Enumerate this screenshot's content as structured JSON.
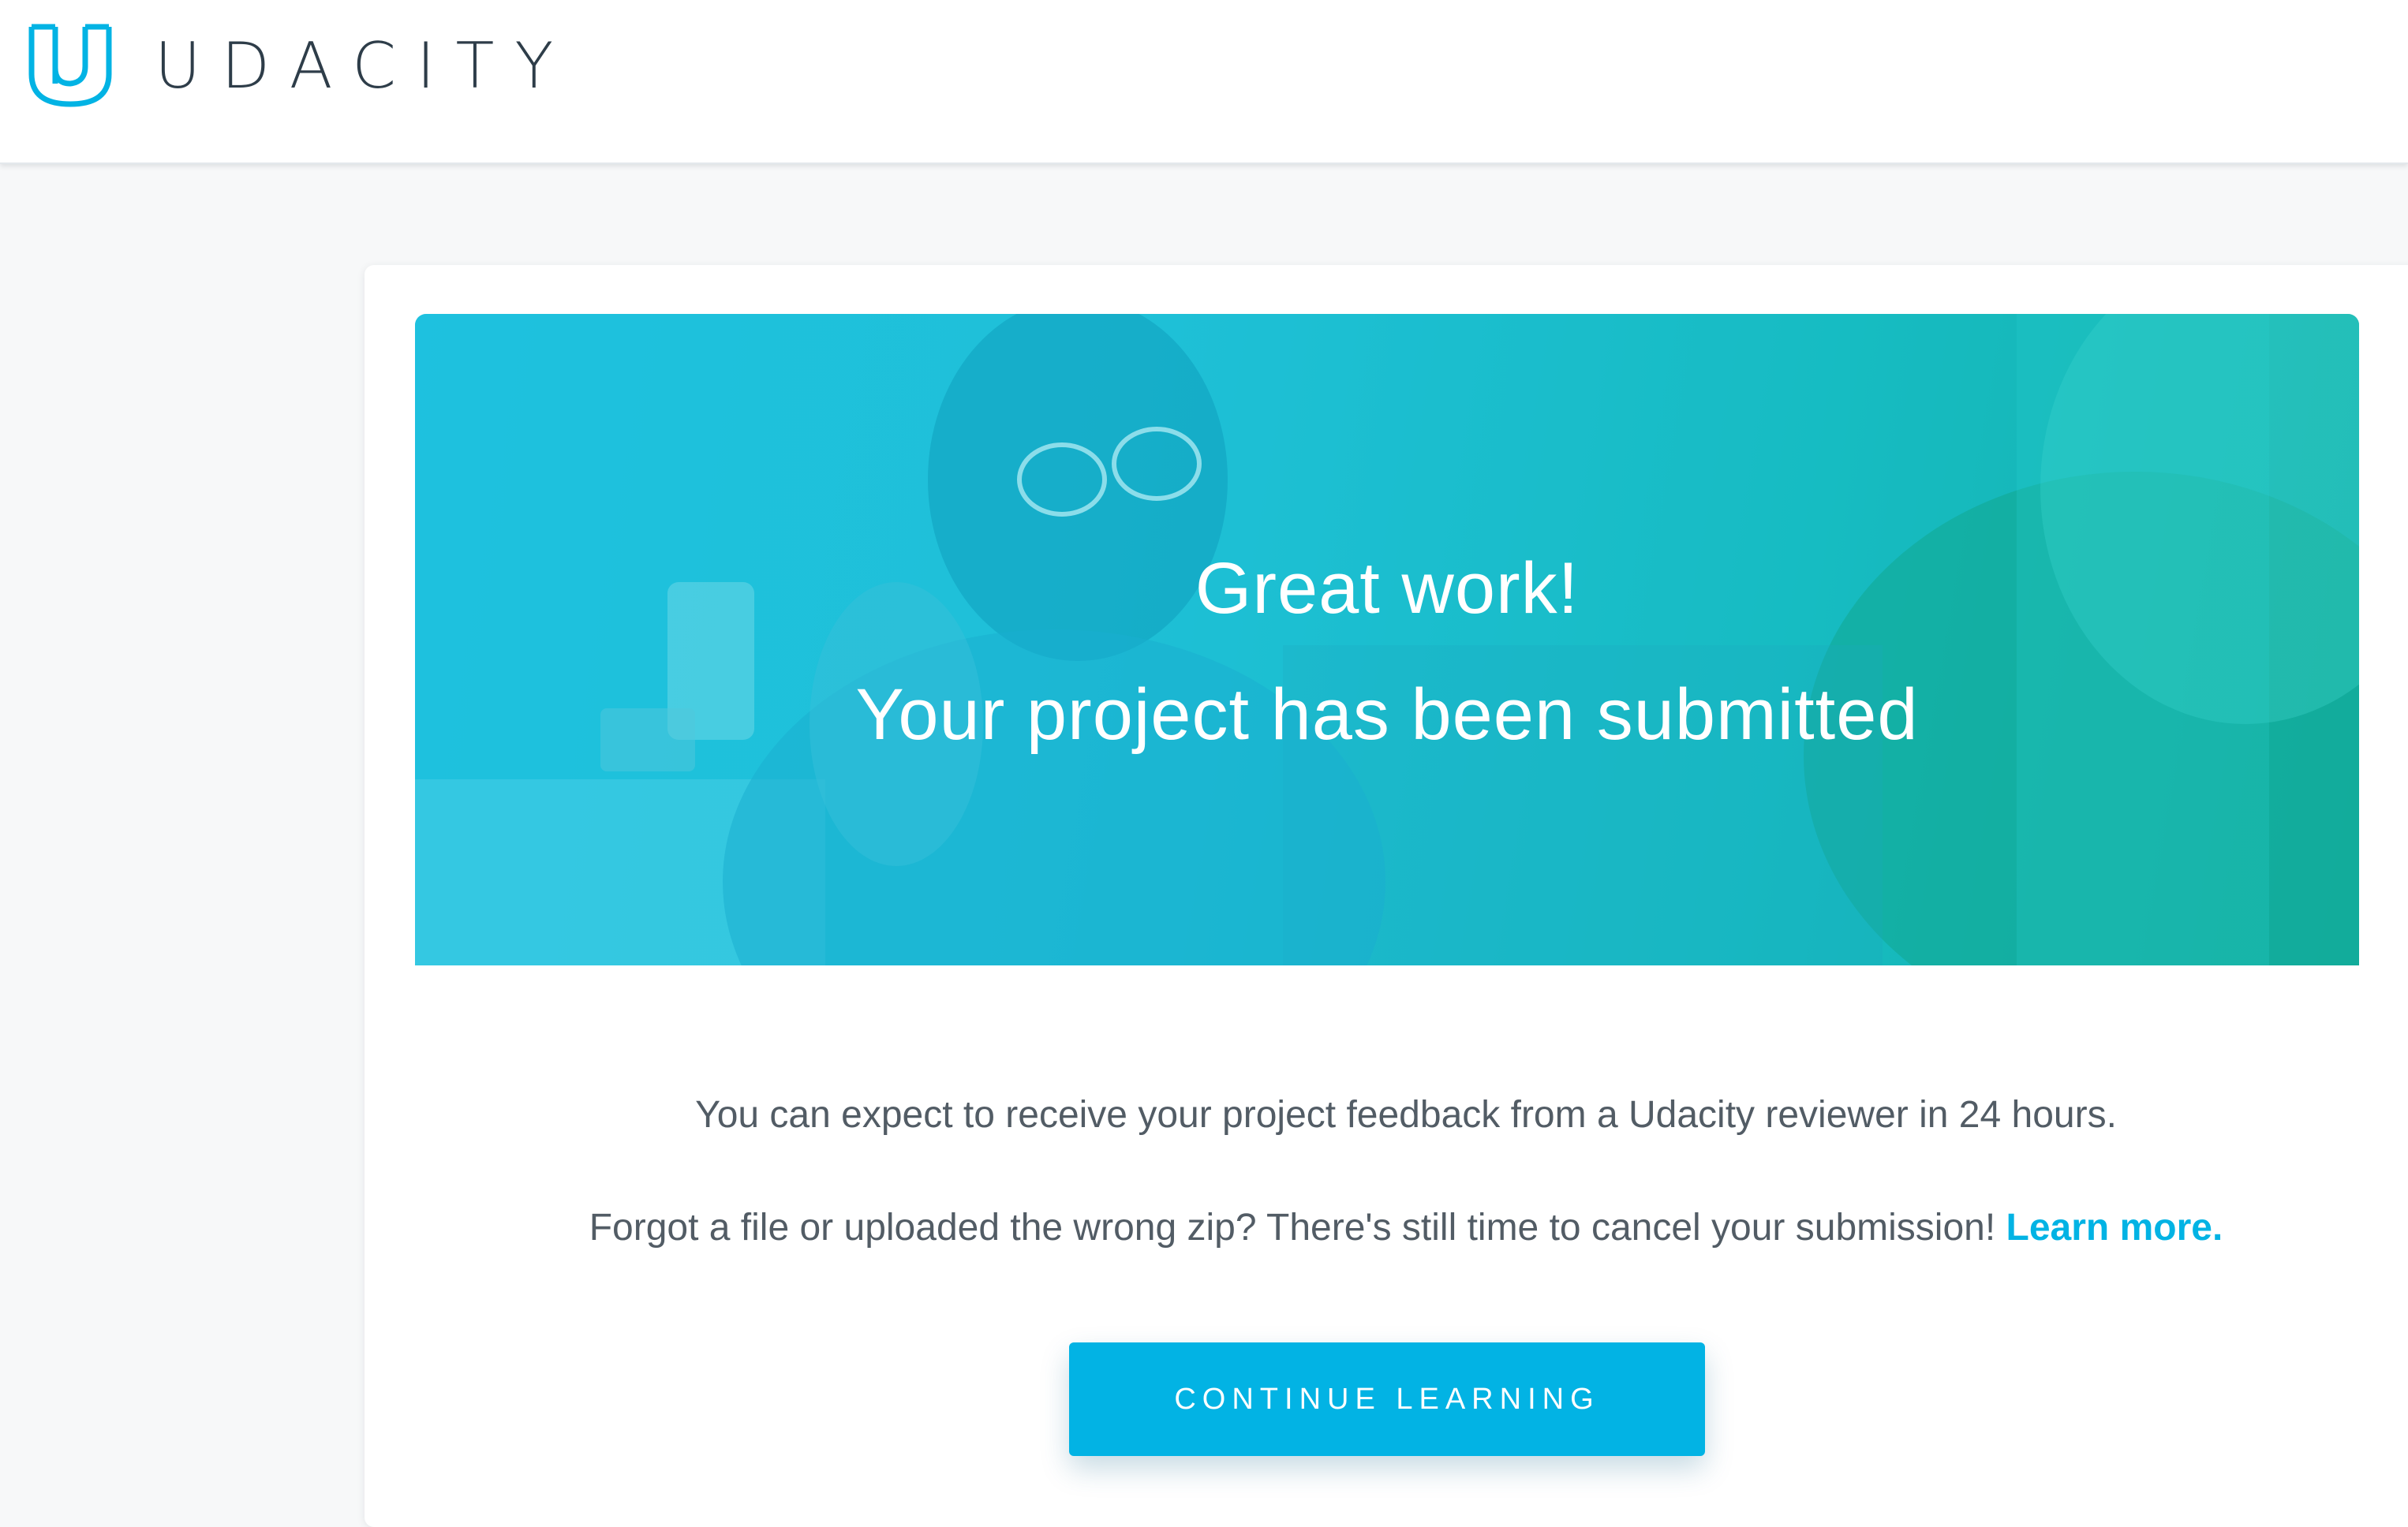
{
  "header": {
    "logo_text": "UDACITY",
    "logo_icon": "udacity-u-logo-icon"
  },
  "hero": {
    "line1": "Great work!",
    "line2": "Your project has been submitted",
    "background_colors": [
      "#1ec1e0",
      "#12b8b4",
      "#10a991"
    ]
  },
  "main": {
    "feedback_text": "You can expect to receive your project feedback from a Udacity reviewer in 24 hours.",
    "cancel_text": "Forgot a file or uploaded the wrong zip? There's still time to cancel your submission!",
    "learn_more_label": "Learn more.",
    "continue_button_label": "CONTINUE LEARNING"
  },
  "colors": {
    "accent": "#02b3e4",
    "text": "#525c65",
    "logo_text": "#2e3d49"
  }
}
